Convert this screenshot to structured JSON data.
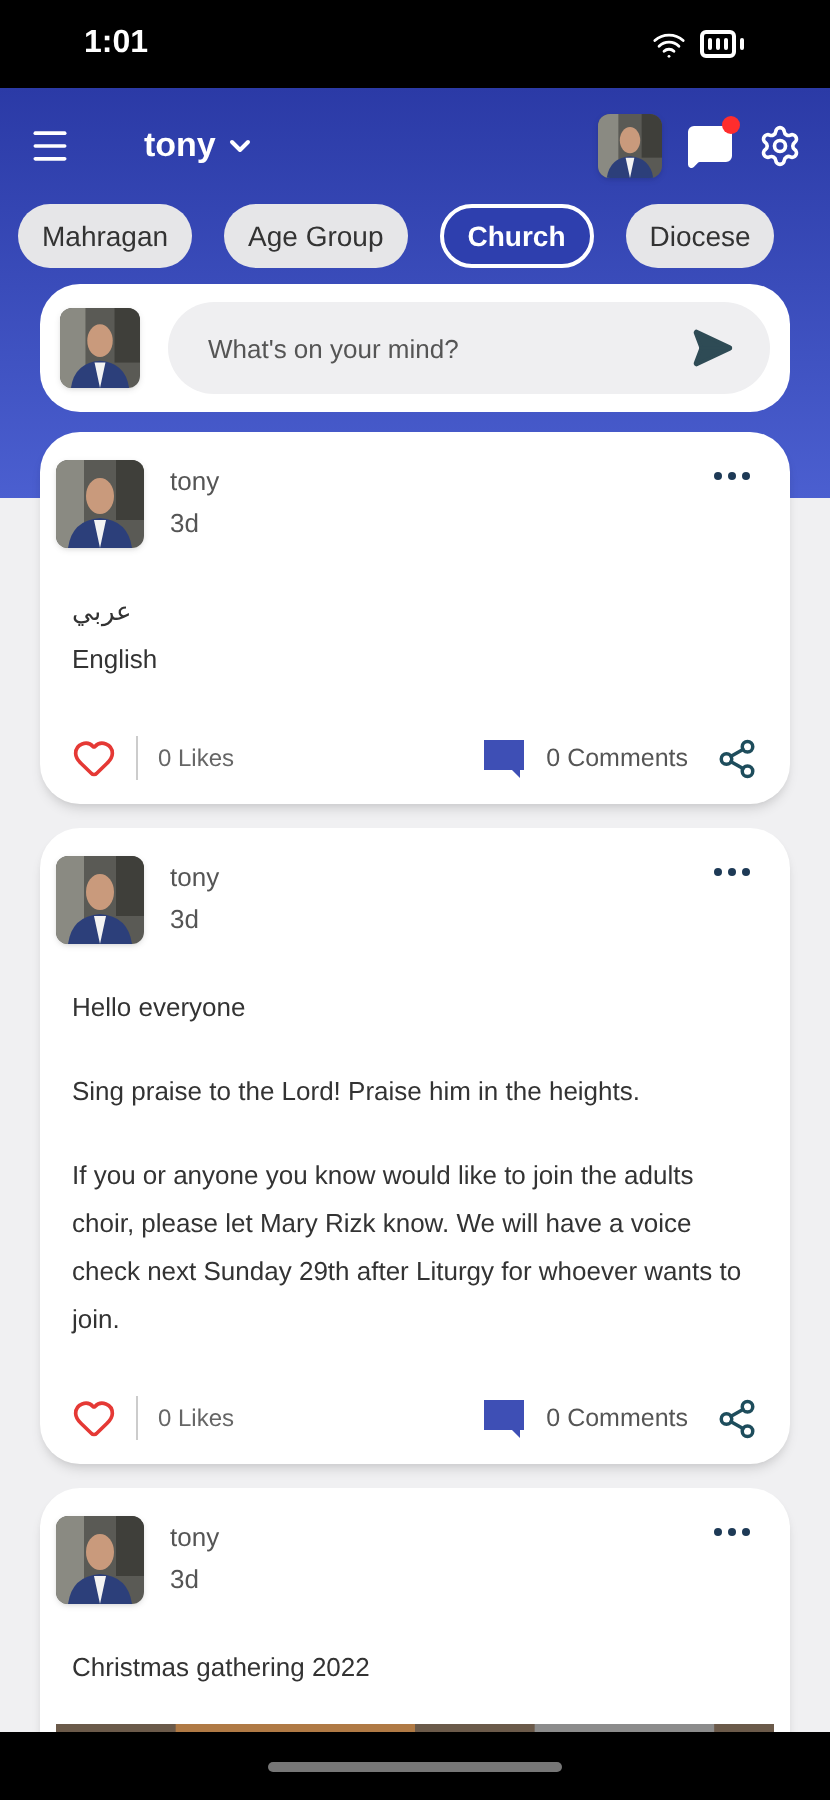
{
  "status_bar": {
    "time": "1:01"
  },
  "header": {
    "user": "tony",
    "notification": true
  },
  "chips": [
    {
      "label": "Mahragan",
      "selected": false
    },
    {
      "label": "Age Group",
      "selected": false
    },
    {
      "label": "Church",
      "selected": true
    },
    {
      "label": "Diocese",
      "selected": false
    }
  ],
  "composer": {
    "placeholder": "What's on your mind?"
  },
  "posts": [
    {
      "author": "tony",
      "time": "3d",
      "paragraphs": [
        "عربي\nEnglish"
      ],
      "liked": false,
      "likes": "0 Likes",
      "comments": "0 Comments"
    },
    {
      "author": "tony",
      "time": "3d",
      "paragraphs": [
        "Hello everyone",
        "Sing praise to the Lord! Praise him in the heights.",
        "If you or anyone you know would like to join the adults choir, please let Mary Rizk know. We will have a voice check next Sunday 29th after Liturgy for whoever wants to join."
      ],
      "liked": false,
      "likes": "0 Likes",
      "comments": "0 Comments"
    },
    {
      "author": "tony",
      "time": "3d",
      "paragraphs": [
        "Christmas gathering 2022"
      ]
    }
  ]
}
